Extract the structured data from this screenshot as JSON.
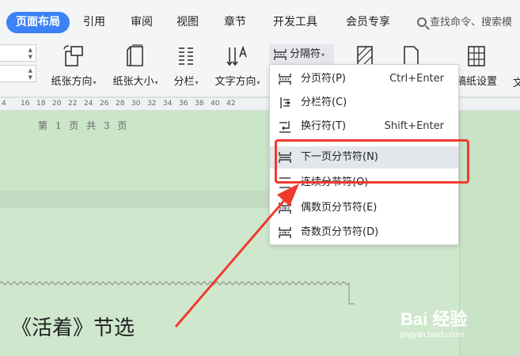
{
  "tabs": [
    {
      "label": "页面布局",
      "active": true
    },
    {
      "label": "引用"
    },
    {
      "label": "审阅"
    },
    {
      "label": "视图"
    },
    {
      "label": "章节"
    },
    {
      "label": "开发工具"
    },
    {
      "label": "会员专享"
    }
  ],
  "search": {
    "text": "查找命令、搜索模"
  },
  "ribbon": {
    "orientation": "纸张方向",
    "size": "纸张大小",
    "columns": "分栏",
    "text_direction": "文字方向",
    "separator": "分隔符",
    "paper_settings": "稿纸设置",
    "cut_label": "文"
  },
  "ruler": [
    "4",
    "16",
    "18",
    "20",
    "22",
    "24",
    "26",
    "28",
    "30",
    "32",
    "34",
    "36",
    "38",
    "40",
    "42"
  ],
  "document": {
    "footer": "第 1 页 共 3 页",
    "body": "《活着》节选"
  },
  "menu": {
    "items": [
      {
        "label": "分页符(P)",
        "shortcut": "Ctrl+Enter",
        "icon": "page-break-icon"
      },
      {
        "label": "分栏符(C)",
        "shortcut": "",
        "icon": "column-break-icon"
      },
      {
        "label": "换行符(T)",
        "shortcut": "Shift+Enter",
        "icon": "line-break-icon"
      },
      {
        "label": "下一页分节符(N)",
        "shortcut": "",
        "icon": "next-page-section-icon",
        "highlighted": true
      },
      {
        "label": "连续分节符(O)",
        "shortcut": "",
        "icon": "continuous-section-icon"
      },
      {
        "label": "偶数页分节符(E)",
        "shortcut": "",
        "icon": "even-page-section-icon"
      },
      {
        "label": "奇数页分节符(D)",
        "shortcut": "",
        "icon": "odd-page-section-icon"
      }
    ]
  },
  "watermark": {
    "brand": "Bai 经验",
    "sub": "jingyan.baidu.com"
  },
  "colors": {
    "accent": "#3b82f6",
    "annotation": "#f03a2e",
    "page": "#cfe8cd"
  }
}
